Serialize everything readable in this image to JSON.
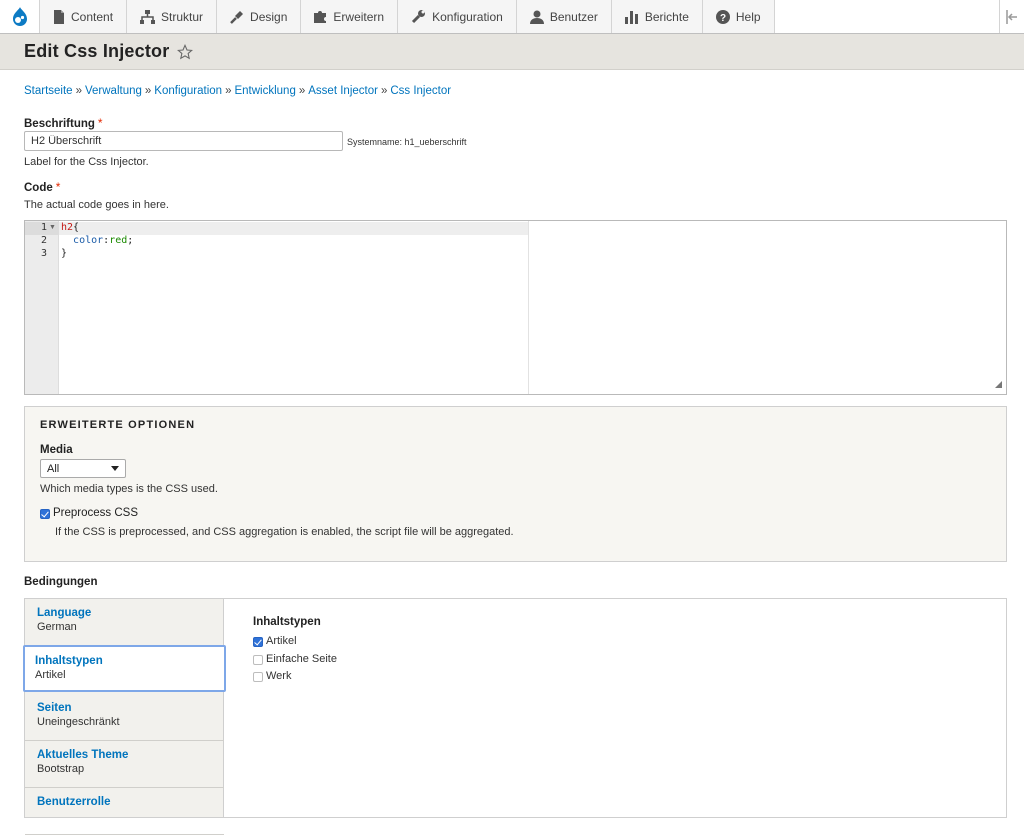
{
  "toolbar": {
    "items": [
      {
        "label": "Content",
        "icon": "file-icon"
      },
      {
        "label": "Struktur",
        "icon": "hierarchy-icon"
      },
      {
        "label": "Design",
        "icon": "paintbrush-icon"
      },
      {
        "label": "Erweitern",
        "icon": "puzzle-icon"
      },
      {
        "label": "Konfiguration",
        "icon": "wrench-icon"
      },
      {
        "label": "Benutzer",
        "icon": "user-icon"
      },
      {
        "label": "Berichte",
        "icon": "bar-chart-icon"
      },
      {
        "label": "Help",
        "icon": "help-icon"
      }
    ]
  },
  "page": {
    "title": "Edit Css Injector"
  },
  "breadcrumb": [
    "Startseite",
    "Verwaltung",
    "Konfiguration",
    "Entwicklung",
    "Asset Injector",
    "Css Injector"
  ],
  "label_field": {
    "label": "Beschriftung",
    "required": "*",
    "value": "H2 Überschrift",
    "machine_name": "Systemname: h1_ueberschrift",
    "description": "Label for the Css Injector."
  },
  "code_field": {
    "label": "Code",
    "required": "*",
    "description": "The actual code goes in here.",
    "line_numbers": [
      "1",
      "2",
      "3"
    ],
    "lines": [
      "h2{",
      "  color:red;",
      "}"
    ]
  },
  "advanced": {
    "title": "ERWEITERTE OPTIONEN",
    "media_label": "Media",
    "media_value": "All",
    "media_description": "Which media types is the CSS used.",
    "preprocess_label": "Preprocess CSS",
    "preprocess_checked": true,
    "preprocess_description": "If the CSS is preprocessed, and CSS aggregation is enabled, the script file will be aggregated."
  },
  "conditions": {
    "title": "Bedingungen",
    "tabs": [
      {
        "title": "Language",
        "summary": "German"
      },
      {
        "title": "Inhaltstypen",
        "summary": "Artikel"
      },
      {
        "title": "Seiten",
        "summary": "Uneingeschränkt"
      },
      {
        "title": "Aktuelles Theme",
        "summary": "Bootstrap"
      },
      {
        "title": "Benutzerrolle",
        "summary": ""
      }
    ],
    "pane_title": "Inhaltstypen",
    "options": [
      {
        "label": "Artikel",
        "checked": true
      },
      {
        "label": "Einfache Seite",
        "checked": false
      },
      {
        "label": "Werk",
        "checked": false
      }
    ]
  },
  "colors": {
    "link": "#0074bd",
    "required": "#e32700",
    "checkbox": "#2f72d8",
    "focus": "#7ea7e8"
  }
}
